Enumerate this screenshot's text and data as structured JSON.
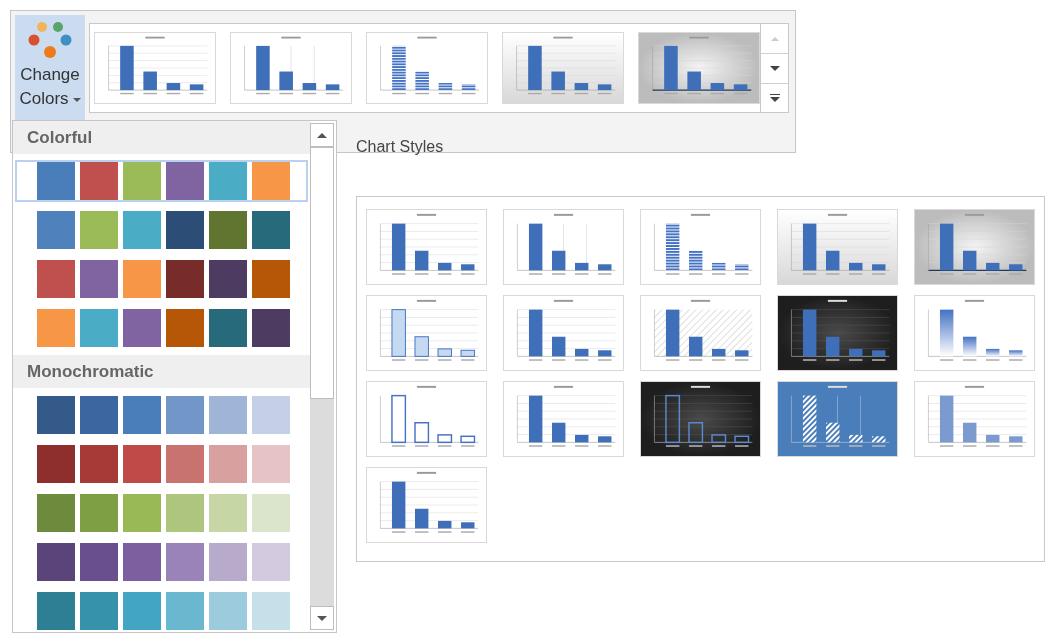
{
  "change_colors": {
    "label": "Change Colors"
  },
  "ribbon_gallery": {
    "group_label": "Chart Styles",
    "thumbnails": [
      {
        "kind": "gridlines"
      },
      {
        "kind": "divided"
      },
      {
        "kind": "striped"
      },
      {
        "kind": "gradient"
      },
      {
        "kind": "gray"
      }
    ],
    "scroll_up": {
      "disabled": true
    }
  },
  "color_dropdown": {
    "sections": [
      {
        "title": "Colorful",
        "rows": [
          {
            "selected": true,
            "colors": [
              {
                "color": "#4a7ebb"
              },
              {
                "color": "#c0504d"
              },
              {
                "color": "#9bbb59"
              },
              {
                "color": "#8064a2"
              },
              {
                "color": "#4bacc6"
              },
              {
                "color": "#f79646"
              }
            ]
          },
          {
            "selected": false,
            "colors": [
              {
                "color": "#4f81bd"
              },
              {
                "color": "#9bbb59"
              },
              {
                "color": "#4bacc6"
              },
              {
                "color": "#2c4d75"
              },
              {
                "color": "#5f7530"
              },
              {
                "color": "#276a7c"
              }
            ]
          },
          {
            "selected": false,
            "colors": [
              {
                "color": "#c0504d"
              },
              {
                "color": "#8064a2"
              },
              {
                "color": "#f79646"
              },
              {
                "color": "#772c2a"
              },
              {
                "color": "#4d3b62"
              },
              {
                "color": "#b65708"
              }
            ]
          },
          {
            "selected": false,
            "colors": [
              {
                "color": "#f79646"
              },
              {
                "color": "#4bacc6"
              },
              {
                "color": "#8064a2"
              },
              {
                "color": "#b65708"
              },
              {
                "color": "#276a7c"
              },
              {
                "color": "#4d3b62"
              }
            ]
          }
        ]
      },
      {
        "title": "Monochromatic",
        "rows": [
          {
            "selected": false,
            "colors": [
              {
                "color": "#345a8a"
              },
              {
                "color": "#3b66a0"
              },
              {
                "color": "#4a7ebb"
              },
              {
                "color": "#7396c8"
              },
              {
                "color": "#a0b4d8"
              },
              {
                "color": "#c5d0e6"
              }
            ]
          },
          {
            "selected": false,
            "colors": [
              {
                "color": "#8e2f2d"
              },
              {
                "color": "#a73a37"
              },
              {
                "color": "#be4b48"
              },
              {
                "color": "#c97371"
              },
              {
                "color": "#d9a0a0"
              },
              {
                "color": "#e6c3c5"
              }
            ]
          },
          {
            "selected": false,
            "colors": [
              {
                "color": "#6e8b3d"
              },
              {
                "color": "#7f9f44"
              },
              {
                "color": "#98b955"
              },
              {
                "color": "#adc57c"
              },
              {
                "color": "#c6d6a5"
              },
              {
                "color": "#dbe5cb"
              }
            ]
          },
          {
            "selected": false,
            "colors": [
              {
                "color": "#5a447a"
              },
              {
                "color": "#6a4f8f"
              },
              {
                "color": "#7d5fa0"
              },
              {
                "color": "#9a83b9"
              },
              {
                "color": "#b8aacb"
              },
              {
                "color": "#d3cadf"
              }
            ]
          },
          {
            "selected": false,
            "colors": [
              {
                "color": "#2e7f93"
              },
              {
                "color": "#3592aa"
              },
              {
                "color": "#42a6c2"
              },
              {
                "color": "#6ab8d0"
              },
              {
                "color": "#9bcbdc"
              },
              {
                "color": "#c5e0e8"
              }
            ]
          }
        ]
      }
    ]
  },
  "expanded_gallery": {
    "thumbnails": [
      {
        "kind": "gridlines"
      },
      {
        "kind": "divided"
      },
      {
        "kind": "striped"
      },
      {
        "kind": "gradient"
      },
      {
        "kind": "gray"
      },
      {
        "kind": "light"
      },
      {
        "kind": "gridlines"
      },
      {
        "kind": "hatchgrid"
      },
      {
        "kind": "dark"
      },
      {
        "kind": "fading"
      },
      {
        "kind": "outline"
      },
      {
        "kind": "gridlines"
      },
      {
        "kind": "darkoutline"
      },
      {
        "kind": "bluehatched"
      },
      {
        "kind": "pale"
      },
      {
        "kind": "gridlines"
      }
    ]
  }
}
